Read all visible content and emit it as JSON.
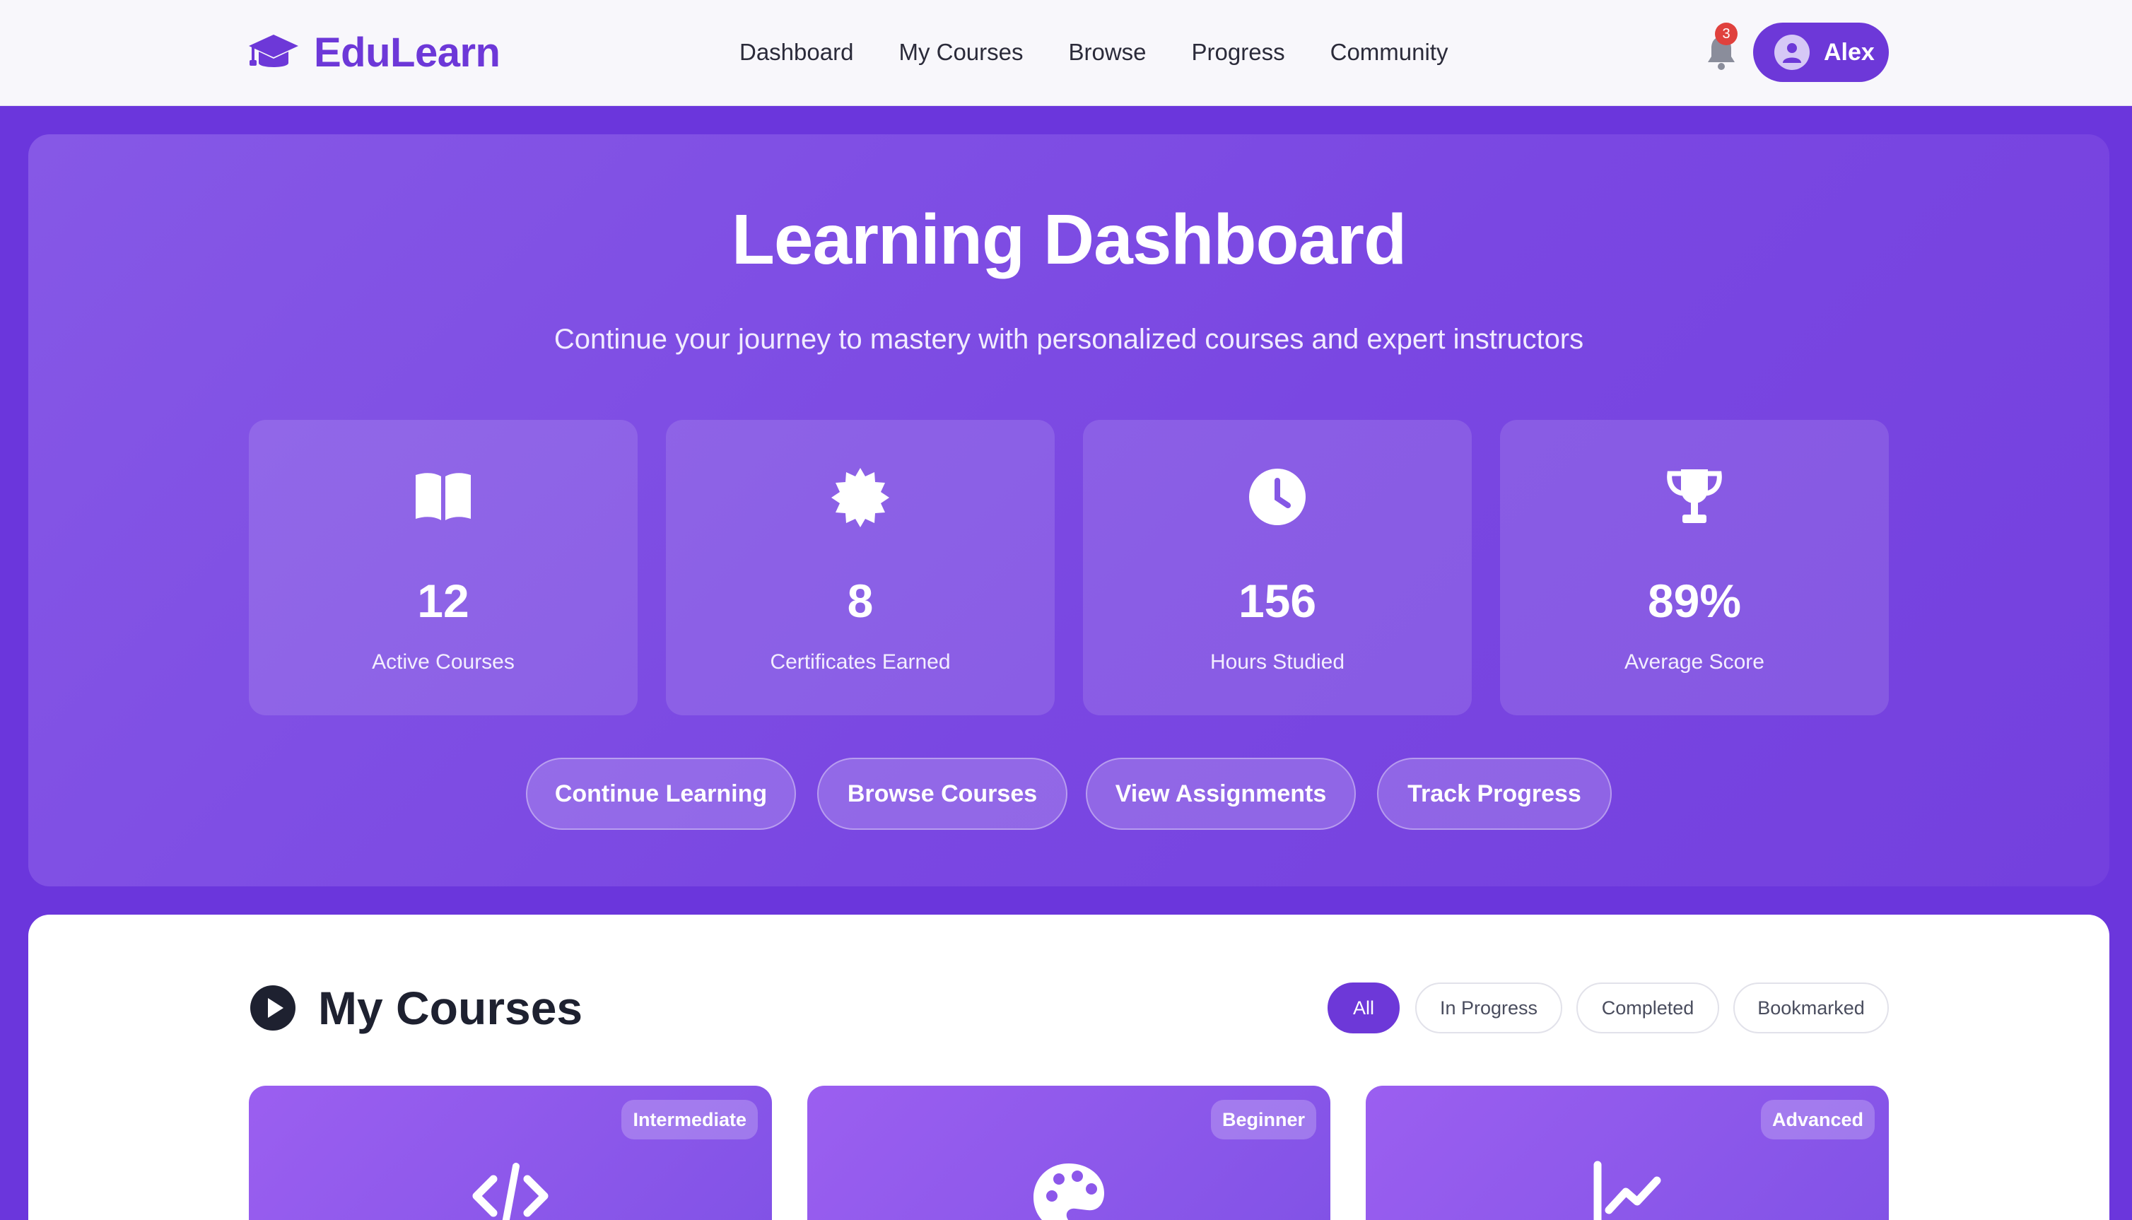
{
  "app": {
    "name": "EduLearn"
  },
  "nav": {
    "items": [
      {
        "label": "Dashboard"
      },
      {
        "label": "My Courses"
      },
      {
        "label": "Browse"
      },
      {
        "label": "Progress"
      },
      {
        "label": "Community"
      }
    ]
  },
  "header": {
    "notification_count": "3",
    "user_name": "Alex",
    "icons": {
      "logo": "graduation-cap-icon",
      "notifications": "bell-icon",
      "avatar": "user-icon"
    }
  },
  "hero": {
    "title": "Learning Dashboard",
    "subtitle": "Continue your journey to mastery with personalized courses and expert instructors",
    "stats": [
      {
        "value": "12",
        "label": "Active Courses",
        "icon": "book-icon"
      },
      {
        "value": "8",
        "label": "Certificates Earned",
        "icon": "certificate-icon"
      },
      {
        "value": "156",
        "label": "Hours Studied",
        "icon": "clock-icon"
      },
      {
        "value": "89%",
        "label": "Average Score",
        "icon": "trophy-icon"
      }
    ],
    "actions": [
      {
        "label": "Continue Learning"
      },
      {
        "label": "Browse Courses"
      },
      {
        "label": "View Assignments"
      },
      {
        "label": "Track Progress"
      }
    ]
  },
  "courses": {
    "title": "My Courses",
    "filters": [
      {
        "label": "All",
        "active": true
      },
      {
        "label": "In Progress",
        "active": false
      },
      {
        "label": "Completed",
        "active": false
      },
      {
        "label": "Bookmarked",
        "active": false
      }
    ],
    "cards": [
      {
        "level": "Intermediate",
        "icon": "code-icon"
      },
      {
        "level": "Beginner",
        "icon": "palette-icon"
      },
      {
        "level": "Advanced",
        "icon": "chart-line-icon"
      }
    ]
  },
  "colors": {
    "brand": "#6d38d8",
    "page_background": "#6b36dc",
    "badge": "#e0413d",
    "text_dark": "#1e2130"
  }
}
